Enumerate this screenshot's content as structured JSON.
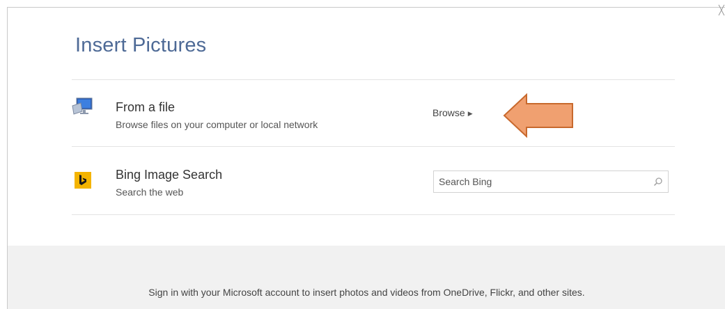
{
  "dialog": {
    "title": "Insert Pictures"
  },
  "sources": [
    {
      "icon": "computer-icon",
      "title": "From a file",
      "subtitle": "Browse files on your computer or local network",
      "action_label": "Browse"
    },
    {
      "icon": "bing-logo-icon",
      "title": "Bing Image Search",
      "subtitle": "Search the web",
      "search_placeholder": "Search Bing"
    }
  ],
  "footer": {
    "message": "Sign in with your Microsoft account to insert photos and videos from OneDrive, Flickr, and other sites."
  },
  "colors": {
    "title": "#4e6a96",
    "bing": "#f4b400",
    "callout_fill": "#f0a070",
    "callout_stroke": "#c8692d",
    "footer_bg": "#f1f1f1"
  }
}
